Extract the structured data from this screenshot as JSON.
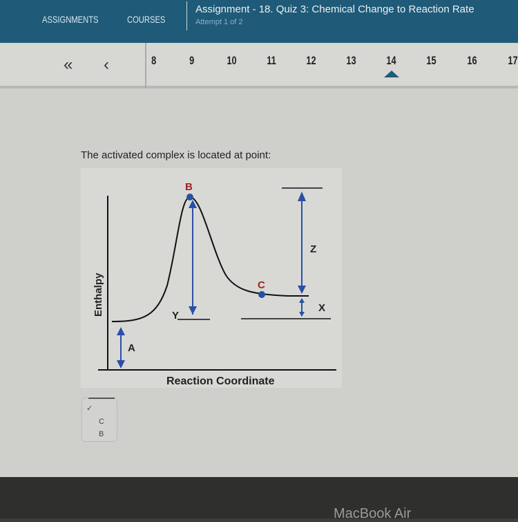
{
  "header": {
    "nav": [
      "ASSIGNMENTS",
      "COURSES"
    ],
    "title": "Assignment  - 18. Quiz 3: Chemical Change to Reaction Rate",
    "attempt": "Attempt 1 of 2"
  },
  "question_nav": {
    "first_icon": "double-chevron-left-icon",
    "prev_icon": "chevron-left-icon",
    "numbers": [
      "8",
      "9",
      "10",
      "11",
      "12",
      "13",
      "14",
      "15",
      "16",
      "17"
    ],
    "current": "14",
    "first": "«",
    "prev": "‹"
  },
  "question": {
    "text": "The activated complex is located at point:"
  },
  "diagram": {
    "y_axis": "Enthalpy",
    "x_axis": "Reaction  Coordinate",
    "labels": {
      "A": "A",
      "B": "B",
      "C": "C",
      "X": "X",
      "Y": "Y",
      "Z": "Z"
    },
    "colors": {
      "curve": "#111111",
      "arrow": "#2a4fa8",
      "label_point": "#a0201e"
    }
  },
  "answer_select": {
    "selected": "",
    "options": [
      "",
      "C",
      "B"
    ],
    "check": "✓"
  },
  "device": {
    "brand": "MacBook Air"
  }
}
